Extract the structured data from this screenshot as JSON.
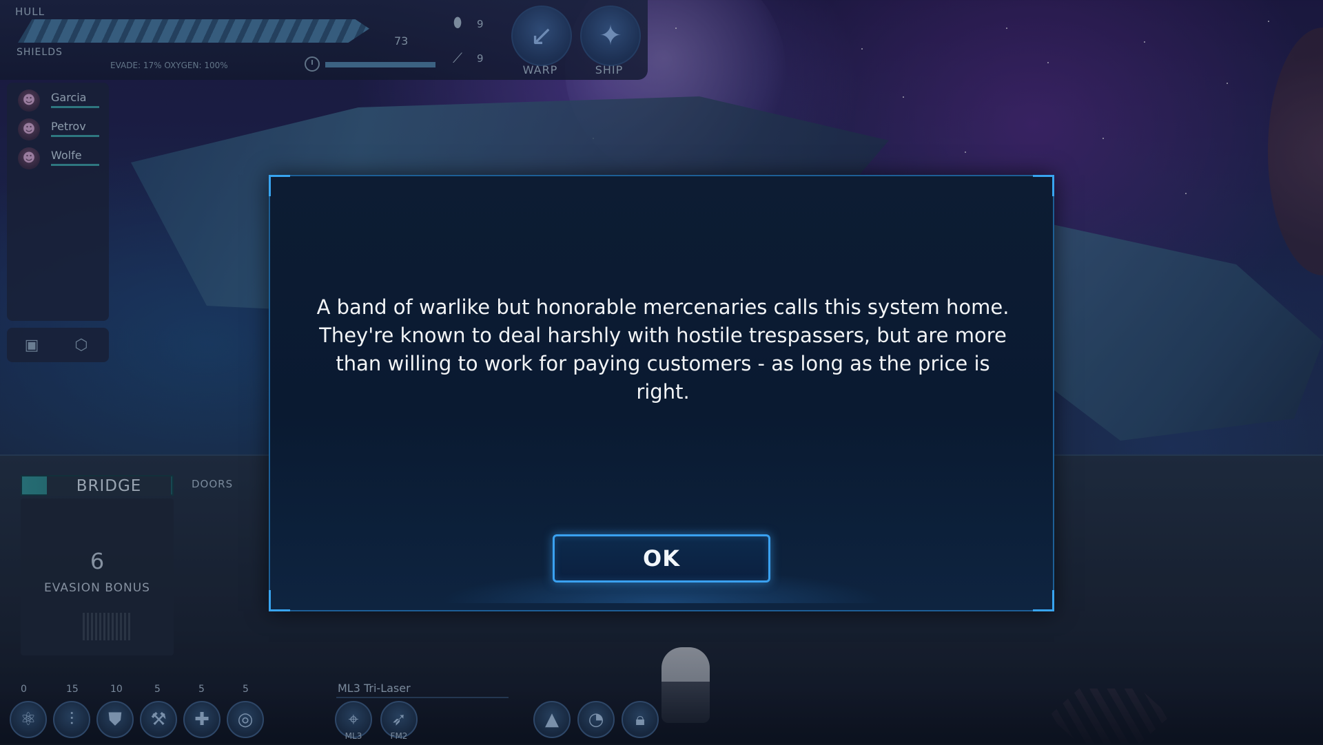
{
  "hud": {
    "hull_label": "HULL",
    "shields_label": "SHIELDS",
    "evade_oxygen": "EVADE: 17%  OXYGEN: 100%",
    "hull_value": "73",
    "oxygen_level": 1.0,
    "resource_top": "9",
    "resource_bottom": "9",
    "warp_label": "WARP",
    "ship_label": "SHIP",
    "warp_icon": "warp-swirl-icon",
    "ship_icon": "ship-star-icon"
  },
  "crew": [
    {
      "name": "Garcia"
    },
    {
      "name": "Petrov"
    },
    {
      "name": "Wolfe"
    }
  ],
  "room": {
    "title": "BRIDGE",
    "doors_label": "DOORS",
    "evasion_value": "6",
    "evasion_label": "EVASION BONUS"
  },
  "actions": [
    {
      "count": "0",
      "icon": "atom-icon"
    },
    {
      "count": "15",
      "icon": "ammo-icon"
    },
    {
      "count": "10",
      "icon": "shield-chevron-icon"
    },
    {
      "count": "5",
      "icon": "repair-icon"
    },
    {
      "count": "5",
      "icon": "medkit-plus-icon"
    },
    {
      "count": "5",
      "icon": "target-ring-icon"
    }
  ],
  "weapons": {
    "title": "ML3 Tri-Laser",
    "slots": [
      {
        "label": "ML3",
        "icon": "laser-turret-icon"
      },
      {
        "label": "FM2",
        "icon": "missile-icon"
      }
    ]
  },
  "systems": [
    {
      "icon": "ship-alert-icon"
    },
    {
      "icon": "radar-dish-icon"
    },
    {
      "icon": "lock-icon"
    }
  ],
  "dialog": {
    "text": "A band of warlike but honorable mercenaries calls this system home. They're known to deal harshly with hostile trespassers, but are more than willing to work for paying customers - as long as the price is right.",
    "ok_label": "OK"
  },
  "colors": {
    "dialog_border": "#38a4f0",
    "dialog_bg": "#0b1b31",
    "bridge_accent": "#2f8c90"
  }
}
